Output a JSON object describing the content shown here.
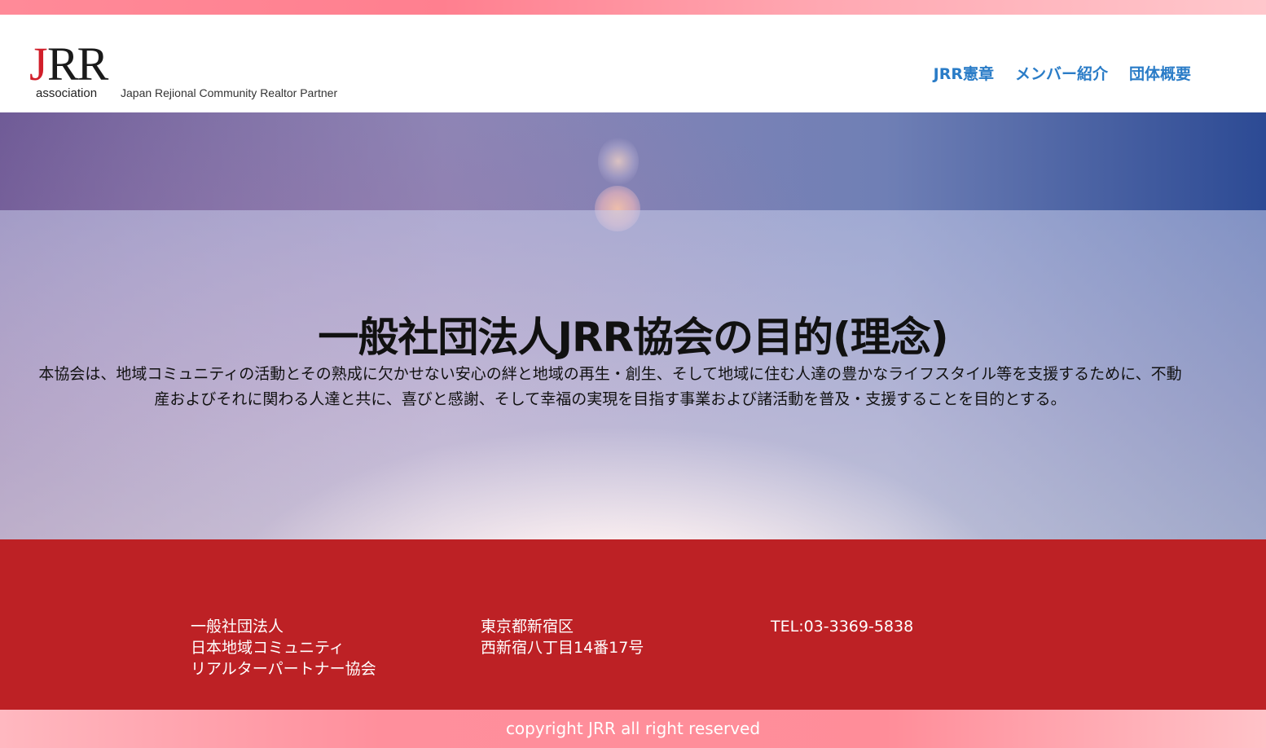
{
  "header": {
    "logo": {
      "mark_j": "J",
      "mark_rr": "RR",
      "subtitle": "association",
      "tagline": "Japan Rejional Community Realtor Partner"
    },
    "nav": [
      {
        "label": "JRR憲章"
      },
      {
        "label": "メンバー紹介"
      },
      {
        "label": "団体概要"
      }
    ]
  },
  "hero": {
    "title": "一般社団法人JRR協会の目的(理念)",
    "body": "本協会は、地域コミュニティの活動とその熟成に欠かせない安心の絆と地域の再生・創生、そして地域に住む人達の豊かなライフスタイル等を支援するために、不動産およびそれに関わる人達と共に、喜びと感謝、そして幸福の実現を目指す事業および諸活動を普及・支援することを目的とする。"
  },
  "footer": {
    "org_lines": [
      "一般社団法人",
      "日本地域コミュニティ",
      "リアルターパートナー協会"
    ],
    "address_lines": [
      "東京都新宿区",
      "西新宿八丁目14番17号"
    ],
    "tel": "TEL:03-3369-5838",
    "copyright": "copyright JRR all right reserved"
  },
  "colors": {
    "nav_link": "#2a7cc7",
    "footer_bg": "#bd2125",
    "logo_red": "#d11f2a"
  }
}
